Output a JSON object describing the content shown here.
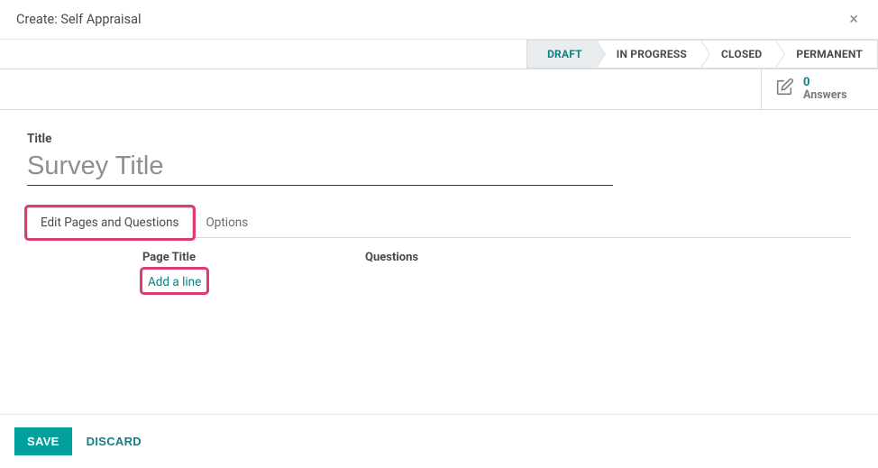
{
  "header": {
    "title": "Create: Self Appraisal",
    "close_glyph": "×"
  },
  "statusbar": {
    "steps": [
      "DRAFT",
      "IN PROGRESS",
      "CLOSED",
      "PERMANENT"
    ],
    "active_index": 0
  },
  "stat_button": {
    "count": "0",
    "label": "Answers",
    "icon_name": "edit-box-icon"
  },
  "form": {
    "title_label": "Title",
    "title_value": "",
    "title_placeholder": "Survey Title"
  },
  "notebook": {
    "tabs": [
      "Edit Pages and Questions",
      "Options"
    ],
    "active_index": 0,
    "columns": {
      "page_title": "Page Title",
      "questions": "Questions"
    },
    "add_line_label": "Add a line",
    "rows": []
  },
  "footer": {
    "save": "SAVE",
    "discard": "DISCARD"
  },
  "highlight": {
    "tab_index": 0,
    "add_line": true
  }
}
